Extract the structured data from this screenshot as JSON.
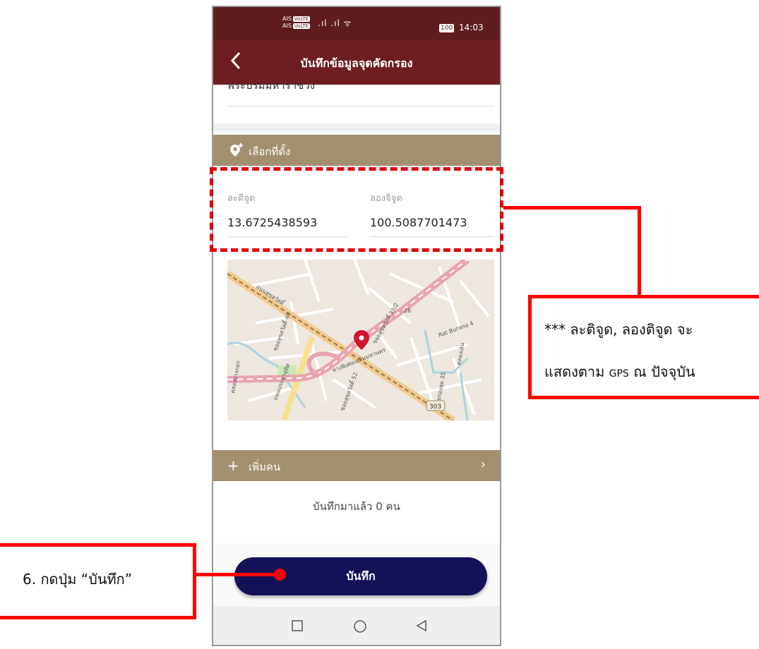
{
  "status_bar": {
    "sim_label_1": "AIS",
    "sim_label_2": "AIS",
    "volte": "VoLTE",
    "signals": ".ıl .ıl ᯤ",
    "battery": "100",
    "time": "14:03"
  },
  "app_bar": {
    "back_icon": "chevron-left-icon",
    "title": "บันทึกข้อมูลจุดคัดกรอง"
  },
  "previous_field_value": "พระบรมมหาราชวัง",
  "location_section": {
    "icon": "add-location-icon",
    "label": "เลือกที่ตั้ง"
  },
  "coordinates": {
    "lat_label": "ละติจูด",
    "lat_value": "13.6725438593",
    "lng_label": "ลองจิจูด",
    "lng_value": "100.5087701473"
  },
  "map": {
    "labels": [
      "ถนนสุขสวัสดิ์",
      "ทางพิเศษเฉลิมมหานคร",
      "ถนนประชาอุทิศ",
      "Rat Burana 4",
      "303",
      "26",
      "ซอยสุขสวัสดิ์ 46",
      "ซอยสุขสวัสดิ์ 52",
      "ซอยสุขสวัสดิ์ 33/2",
      "ซอยร่องสุด 35",
      "คลองบางกอก",
      "คลองเลน"
    ],
    "marker_icon": "map-pin-icon",
    "colors": {
      "land": "#ede7df",
      "water": "#aad3df",
      "expressway": "#e9a4b0",
      "park": "#cde8b8"
    }
  },
  "people_section": {
    "icon": "plus-icon",
    "label": "เพิ่มคน",
    "chevron": "chevron-right-icon"
  },
  "record_count": "บันทึกมาแล้ว 0 คน",
  "save_button": {
    "label": "บันทึก"
  },
  "nav_bar": {
    "square": "recent-apps-icon",
    "circle": "home-icon",
    "triangle": "back-triangle-icon"
  },
  "annotations": {
    "note_line1": "*** ละติจูด, ลองติจูด จะ",
    "note_line2_a": "แสดงตาม",
    "note_line2_gps": "GPS",
    "note_line2_b": "ณ ปัจจุบัน",
    "step_label": "6. กดปุ่ม “บันทึก”",
    "color": "#ff0000"
  }
}
